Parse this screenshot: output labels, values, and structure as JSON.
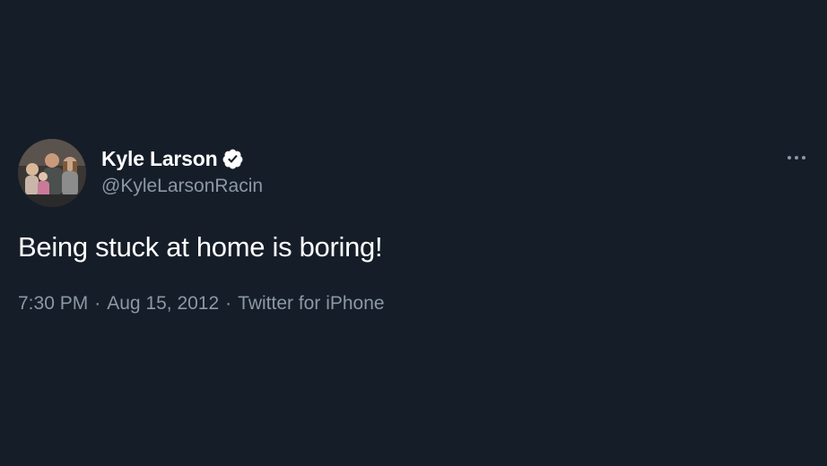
{
  "tweet": {
    "author": {
      "display_name": "Kyle Larson",
      "handle": "@KyleLarsonRacin",
      "verified": true,
      "avatar_icon": "family-photo-avatar"
    },
    "text": "Being stuck at home is boring!",
    "meta": {
      "time": "7:30 PM",
      "separator": "·",
      "date": "Aug 15, 2012",
      "source": "Twitter for iPhone"
    },
    "more_icon": "more-options-icon"
  },
  "colors": {
    "background": "#151d28",
    "primary_text": "#ffffff",
    "secondary_text": "#8b98a5"
  }
}
